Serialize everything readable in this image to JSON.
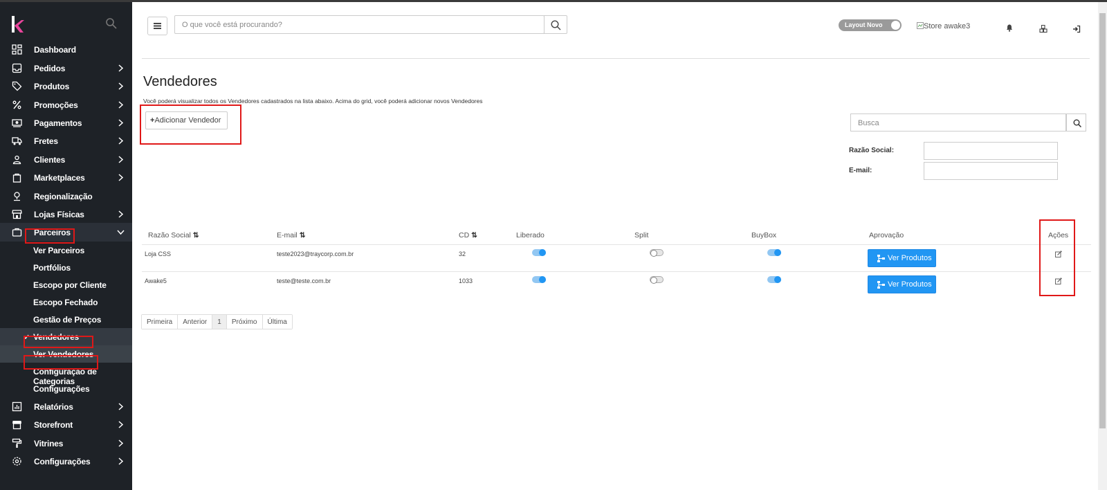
{
  "sidebar": {
    "items": [
      {
        "label": "Dashboard",
        "icon": "grid-icon",
        "chevron": false
      },
      {
        "label": "Pedidos",
        "icon": "inbox-icon",
        "chevron": true
      },
      {
        "label": "Produtos",
        "icon": "tag-icon",
        "chevron": true
      },
      {
        "label": "Promoções",
        "icon": "percent-icon",
        "chevron": true
      },
      {
        "label": "Pagamentos",
        "icon": "money-icon",
        "chevron": true
      },
      {
        "label": "Fretes",
        "icon": "truck-icon",
        "chevron": true
      },
      {
        "label": "Clientes",
        "icon": "user-icon",
        "chevron": true
      },
      {
        "label": "Marketplaces",
        "icon": "bag-icon",
        "chevron": true
      },
      {
        "label": "Regionalização",
        "icon": "pin-icon",
        "chevron": false
      },
      {
        "label": "Lojas Físicas",
        "icon": "store-icon",
        "chevron": true
      },
      {
        "label": "Parceiros",
        "icon": "briefcase-icon",
        "chevron": true
      }
    ],
    "parceiros_sub": [
      {
        "label": "Ver Parceiros"
      },
      {
        "label": "Portfólios"
      },
      {
        "label": "Escopo por Cliente"
      },
      {
        "label": "Escopo Fechado"
      },
      {
        "label": "Gestão de Preços"
      },
      {
        "label": "Vendedores"
      },
      {
        "label": "Ver Vendedores"
      },
      {
        "label": "Configuração de Categorias"
      },
      {
        "label": "Configurações"
      }
    ],
    "bottom_items": [
      {
        "label": "Relatórios",
        "icon": "report-icon"
      },
      {
        "label": "Storefront",
        "icon": "storefront-icon"
      },
      {
        "label": "Vitrines",
        "icon": "paint-roller-icon"
      },
      {
        "label": "Configurações",
        "icon": "gear-icon"
      }
    ]
  },
  "header": {
    "search_placeholder": "O que você está procurando?",
    "layout_toggle_label": "Layout Novo",
    "store_image_alt": "Store awake3"
  },
  "page": {
    "title": "Vendedores",
    "description": "Você poderá visualizar todos os Vendedores cadastrados na lista abaixo. Acima do grid, você poderá adicionar novos Vendedores",
    "add_button": "Adicionar Vendedor",
    "search_placeholder": "Busca",
    "filters": [
      {
        "label": "Razão Social:"
      },
      {
        "label": "E-mail:"
      }
    ]
  },
  "table": {
    "headers": [
      "Razão Social",
      "E-mail",
      "CD",
      "Liberado",
      "Split",
      "BuyBox",
      "Aprovação",
      "Ações"
    ],
    "rows": [
      {
        "razao": "Loja CSS",
        "email": "teste2023@traycorp.com.br",
        "cd": "32",
        "liberado": true,
        "split": false,
        "buybox": true,
        "aprovacao_btn": "Ver Produtos"
      },
      {
        "razao": "Awake5",
        "email": "teste@teste.com.br",
        "cd": "1033",
        "liberado": true,
        "split": false,
        "buybox": true,
        "aprovacao_btn": "Ver Produtos"
      }
    ]
  },
  "pagination": {
    "first": "Primeira",
    "prev": "Anterior",
    "current": "1",
    "next": "Próximo",
    "last": "Última"
  },
  "colors": {
    "sidebar_bg": "#1e2227",
    "primary": "#2196f3",
    "highlight": "#e01818"
  }
}
